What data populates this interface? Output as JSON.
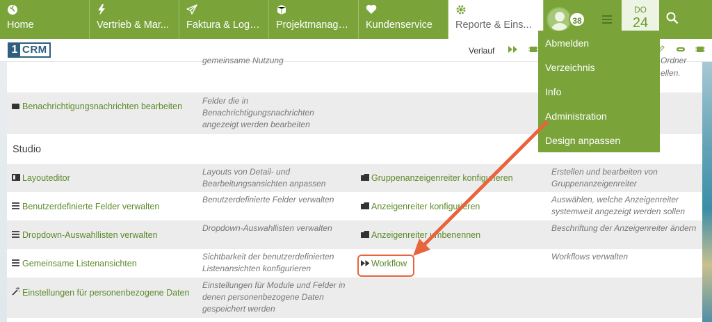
{
  "nav": {
    "tabs": [
      {
        "icon": "globe-icon",
        "label": "Home"
      },
      {
        "icon": "bolt-icon",
        "label": "Vertrieb & Mar..."
      },
      {
        "icon": "paper-plane-icon",
        "label": "Faktura & Logis..."
      },
      {
        "icon": "cube-icon",
        "label": "Projektmanage..."
      },
      {
        "icon": "heart-icon",
        "label": "Kundenservice"
      },
      {
        "icon": "gear-icon",
        "label": "Reporte & Eins..."
      }
    ],
    "badge_count": "38",
    "date_day": "DO",
    "date_num": "24"
  },
  "subbar": {
    "logo_one": "1",
    "logo_crm": "CRM",
    "verlauf": "Verlauf"
  },
  "dropdown": {
    "items": [
      "Abmelden",
      "Verzeichnis",
      "Info",
      "Administration",
      "Design anpassen"
    ]
  },
  "admin": {
    "partial_top_desc": "gemeinsame Nutzung",
    "partial_right_1": "Ordner",
    "partial_right_2": "ellen.",
    "notif_link": "Benachrichtigungsnachrichten bearbeiten",
    "notif_desc": [
      "Felder die in",
      "Benachrichtigungsnachrichten",
      "angezeigt werden bearbeiten"
    ],
    "studio_title": "Studio",
    "rows": [
      {
        "left_link": "Layouteditor",
        "left_desc": [
          "Layouts von Detail- und",
          "Bearbeitungsansichten anpassen"
        ],
        "right_link": "Gruppenanzeigenreiter konfigurieren",
        "right_desc": [
          "Erstellen und bearbeiten von",
          "Gruppenanzeigenreiter"
        ]
      },
      {
        "left_link": "Benutzerdefinierte Felder verwalten",
        "left_desc": [
          "Benutzerdefinierte Felder verwalten"
        ],
        "right_link": "Anzeigenreiter konfigurieren",
        "right_desc": [
          "Auswählen, welche Anzeigenreiter",
          "systemweit angezeigt werden sollen"
        ]
      },
      {
        "left_link": "Dropdown-Auswahllisten verwalten",
        "left_desc": [
          "Dropdown-Auswahllisten verwalten"
        ],
        "right_link": "Anzeigenreiter umbenennen",
        "right_desc": [
          "Beschriftung der Anzeigenreiter ändern"
        ]
      },
      {
        "left_link": "Gemeinsame Listenansichten",
        "left_desc": [
          "Sichtbarkeit der benutzerdefinierten",
          "Listenansichten konfigurieren"
        ],
        "right_link": "Workflow",
        "right_desc": [
          "Workflows verwalten"
        ]
      },
      {
        "left_link": "Einstellungen für personenbezogene Daten",
        "left_desc": [
          "Einstellungen für Module und Felder in",
          "denen personenbezogene Daten",
          "gespeichert werden"
        ],
        "right_link": "",
        "right_desc": []
      }
    ]
  },
  "colors": {
    "brand_green": "#7aa33a",
    "link_green": "#5c8a2a",
    "annotation_orange": "#e8643c"
  }
}
